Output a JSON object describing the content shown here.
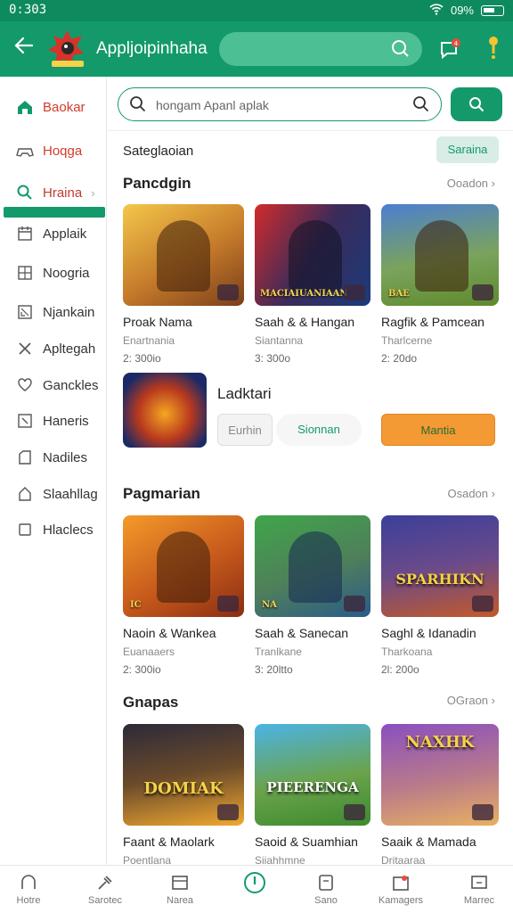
{
  "status_bar": {
    "time": "0:303",
    "battery": "09%"
  },
  "app_bar": {
    "title": "Appljoipinhaha"
  },
  "sidebar": {
    "items": [
      {
        "label": "Baokar",
        "icon": "home-icon"
      },
      {
        "label": "Hoqga",
        "icon": "gamepad-icon"
      },
      {
        "label": "Hraina",
        "icon": "search-icon"
      },
      {
        "label": "Applaik",
        "icon": "calendar-icon"
      },
      {
        "label": "Noogria",
        "icon": "grid-icon"
      },
      {
        "label": "Njankain",
        "icon": "expand-icon"
      },
      {
        "label": "Apltegah",
        "icon": "cross-tools-icon"
      },
      {
        "label": "Ganckles",
        "icon": "heart-icon"
      },
      {
        "label": "Haneris",
        "icon": "inbox-icon"
      },
      {
        "label": "Nadiles",
        "icon": "folder-icon"
      },
      {
        "label": "Slaahllag",
        "icon": "bag-icon"
      },
      {
        "label": "Hlaclecs",
        "icon": "square-icon"
      }
    ]
  },
  "search": {
    "placeholder": "hongam Apanl aplak"
  },
  "category": {
    "header": "Sateglaoian",
    "button": "Saraina"
  },
  "sections": [
    {
      "title": "Pancdgin",
      "link": "Ooadon",
      "cards": [
        {
          "name": "Proak Nama",
          "sub": "Enartnania",
          "meta": "2: 300io",
          "colors": [
            "#f5c74a",
            "#7a3e1a"
          ]
        },
        {
          "name": "Saah & & Hangan",
          "sub": "Siantanna",
          "meta": "3: 300o",
          "colors": [
            "#d22b2b",
            "#1c3a7a"
          ],
          "tag": "MACIAIUANIAAN"
        },
        {
          "name": "Ragfik & Pamcean",
          "sub": "Tharlcerne",
          "meta": "2: 20do",
          "colors": [
            "#4c7fd0",
            "#5e8a2c"
          ],
          "tag": "BAE"
        }
      ]
    },
    {
      "title": "Pagmarian",
      "link": "Osadon",
      "cards": [
        {
          "name": "Naoin & Wankea",
          "sub": "Euanaaers",
          "meta": "2: 300io",
          "colors": [
            "#f59a2a",
            "#8a2d12"
          ],
          "tag": "IC"
        },
        {
          "name": "Saah & Sanecan",
          "sub": "Tranlkane",
          "meta": "3: 20ltto",
          "colors": [
            "#3fa64a",
            "#2a5b8a"
          ],
          "tag": "NA"
        },
        {
          "name": "Saghl & Idanadin",
          "sub": "Tharkoana",
          "meta": "2l: 200o",
          "colors": [
            "#3b3f9a",
            "#c25a2a"
          ],
          "bigtxt": "SPARHIKN"
        }
      ]
    },
    {
      "title": "Gnapas",
      "link": "OGraon",
      "cards": [
        {
          "name": "Faant & Maolark",
          "sub": "Poentlana",
          "colors": [
            "#f0a830",
            "#2c2a3a"
          ],
          "bigtxt": "DOMIAK"
        },
        {
          "name": "Saoid & Suamhian",
          "sub": "Siiahhmne",
          "colors": [
            "#4cb3e6",
            "#3e8a2e"
          ],
          "bigtxt": "PIEERENGA"
        },
        {
          "name": "Saaik & Mamada",
          "sub": "Dritaaraa",
          "colors": [
            "#8a4fc0",
            "#e8b062"
          ],
          "bigtxt": "NAXHK"
        }
      ]
    }
  ],
  "featured": {
    "title": "Ladktari",
    "btn1": "Eurhin",
    "btn2": "Sionnan",
    "btn3": "Mantia"
  },
  "bottom_nav": [
    {
      "label": "Hotre",
      "icon": "home-icon"
    },
    {
      "label": "Sarotec",
      "icon": "tools-icon"
    },
    {
      "label": "Narea",
      "icon": "tray-icon"
    },
    {
      "label": "",
      "icon": "power-icon"
    },
    {
      "label": "Sano",
      "icon": "note-icon"
    },
    {
      "label": "Kamagers",
      "icon": "gift-icon"
    },
    {
      "label": "Marrec",
      "icon": "tv-icon"
    }
  ]
}
